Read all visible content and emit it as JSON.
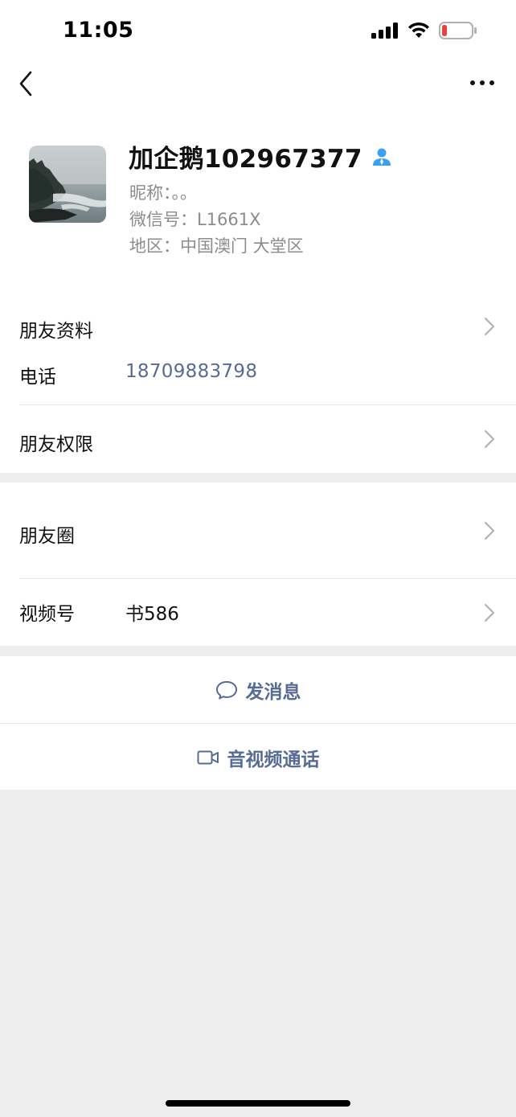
{
  "status_bar": {
    "time": "11:05",
    "battery_color": "#e64340"
  },
  "nav": {
    "back_icon": "chevron-left",
    "more_icon": "ellipsis"
  },
  "profile": {
    "name": "加企鹅102967377",
    "badge_icon": "person-icon",
    "badge_color": "#3aa0f0",
    "nickname": "昵称：。。",
    "wechat_id": "微信号：L1661X",
    "region": "地区：中国澳门 大堂区"
  },
  "info": {
    "friend_profile_label": "朋友资料",
    "phone_label": "电话",
    "phone_value": "18709883798",
    "permissions_label": "朋友权限"
  },
  "social": {
    "moments_label": "朋友圈",
    "channels_label": "视频号",
    "channels_value": "书586"
  },
  "actions": {
    "message_label": "发消息",
    "call_label": "音视频通话",
    "link_color": "#576b95"
  }
}
